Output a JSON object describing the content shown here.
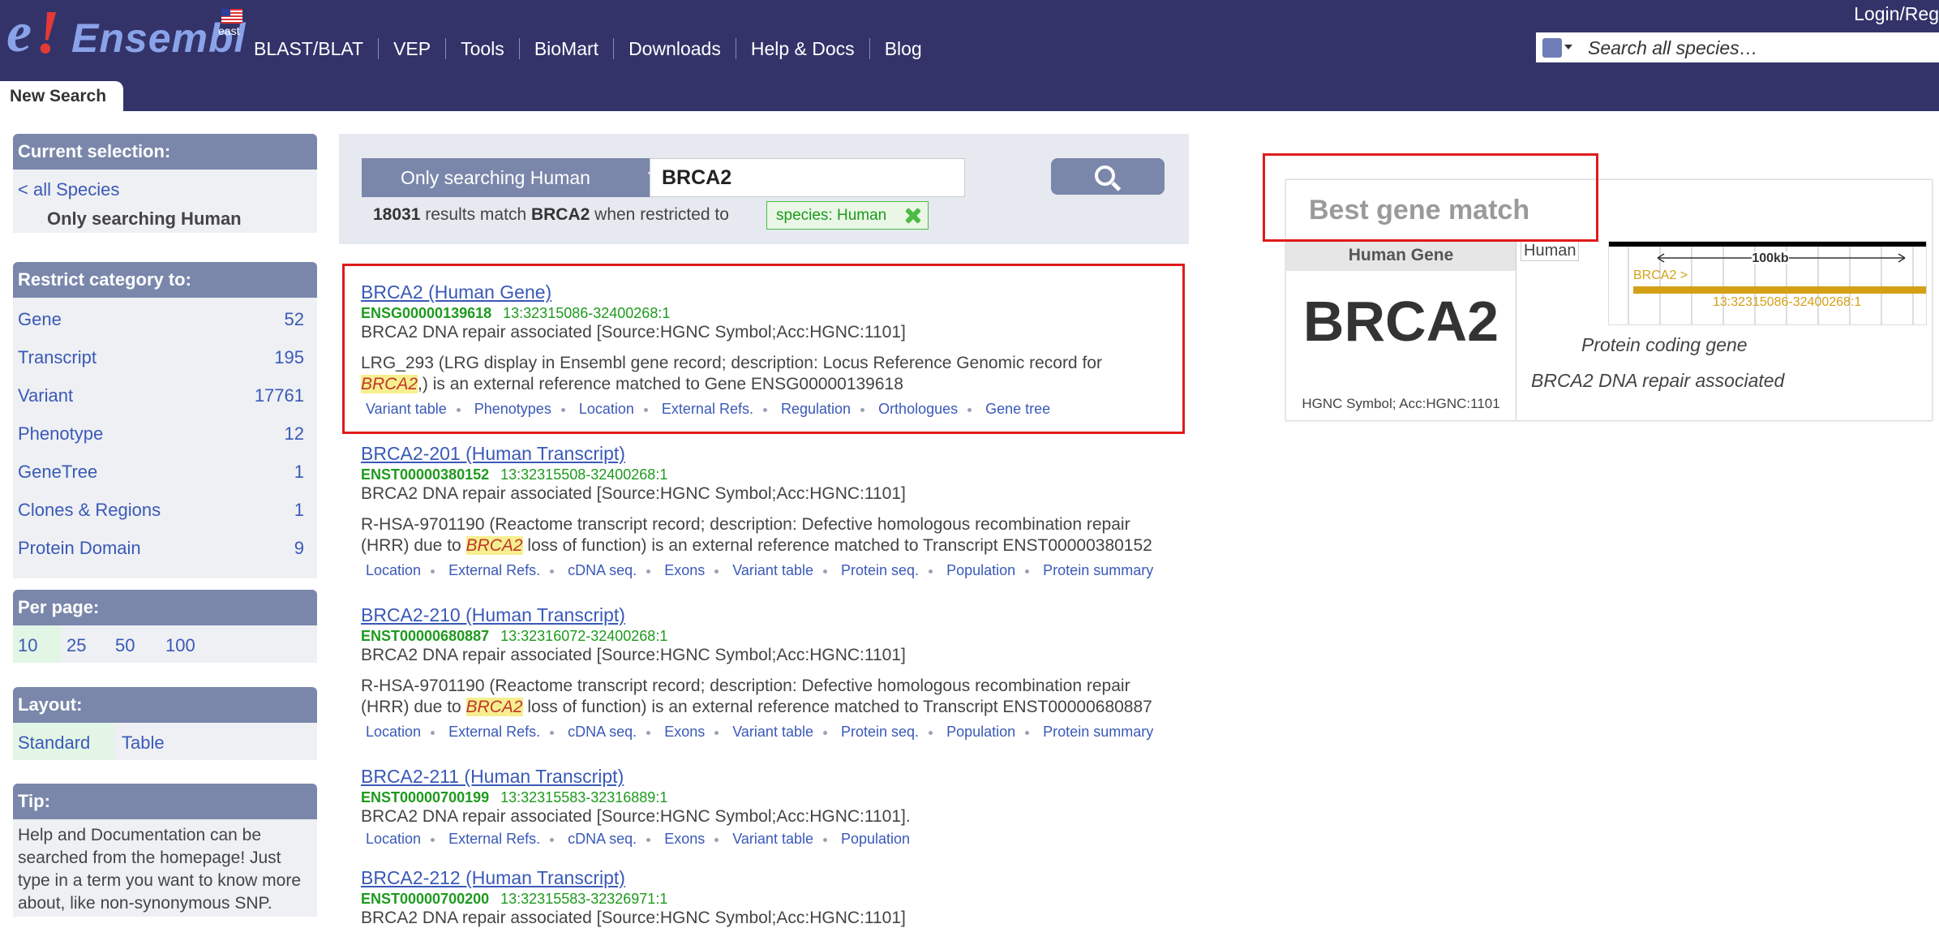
{
  "header": {
    "logo_text": "Ensembl",
    "site_variant": "east",
    "nav": [
      "BLAST/BLAT",
      "VEP",
      "Tools",
      "BioMart",
      "Downloads",
      "Help & Docs",
      "Blog"
    ],
    "login": "Login/Reg",
    "site_search_placeholder": "Search all species…",
    "tab": "New Search"
  },
  "sidebar": {
    "current": {
      "title": "Current selection:",
      "all_species_link": "< all Species",
      "selected": "Only searching Human"
    },
    "restrict": {
      "title": "Restrict category to:",
      "items": [
        {
          "name": "Gene",
          "count": "52"
        },
        {
          "name": "Transcript",
          "count": "195"
        },
        {
          "name": "Variant",
          "count": "17761"
        },
        {
          "name": "Phenotype",
          "count": "12"
        },
        {
          "name": "GeneTree",
          "count": "1"
        },
        {
          "name": "Clones & Regions",
          "count": "1"
        },
        {
          "name": "Protein Domain",
          "count": "9"
        }
      ]
    },
    "per_page": {
      "title": "Per page:",
      "options": [
        "10",
        "25",
        "50",
        "100"
      ],
      "selected": "10"
    },
    "layout": {
      "title": "Layout:",
      "options": [
        "Standard",
        "Table"
      ],
      "selected": "Standard"
    },
    "tip": {
      "title": "Tip:",
      "lines": [
        "Help and Documentation can be",
        "searched from the homepage! Just",
        "type in a term you want to know more",
        "about, like non-synonymous SNP."
      ]
    }
  },
  "search": {
    "restrict_label": "Only searching Human",
    "query": "BRCA2",
    "result_count": "18031",
    "result_mid": "results match",
    "result_query": "BRCA2",
    "result_suffix": "when restricted to",
    "filter_chip": "species: Human"
  },
  "results": [
    {
      "title": "BRCA2 (Human Gene)",
      "stable_id": "ENSG00000139618",
      "location": "13:32315086-32400268:1",
      "desc": "BRCA2 DNA repair associated [Source:HGNC Symbol;Acc:HGNC:1101]",
      "ext_pre": "LRG_293 (LRG display in Ensembl gene record; description: Locus Reference Genomic record for",
      "ext_hl": "BRCA2",
      "ext_post": ",) is an external reference matched to Gene ENSG00000139618",
      "links": [
        "Variant table",
        "Phenotypes",
        "Location",
        "External Refs.",
        "Regulation",
        "Orthologues",
        "Gene tree"
      ]
    },
    {
      "title": "BRCA2-201 (Human Transcript)",
      "stable_id": "ENST00000380152",
      "location": "13:32315508-32400268:1",
      "desc": "BRCA2 DNA repair associated [Source:HGNC Symbol;Acc:HGNC:1101]",
      "ext_pre": "R-HSA-9701190 (Reactome transcript record; description: Defective homologous recombination repair",
      "ext_pre2": "(HRR) due to",
      "ext_hl": "BRCA2",
      "ext_post": "loss of function) is an external reference matched to Transcript ENST00000380152",
      "links": [
        "Location",
        "External Refs.",
        "cDNA seq.",
        "Exons",
        "Variant table",
        "Protein seq.",
        "Population",
        "Protein summary"
      ]
    },
    {
      "title": "BRCA2-210 (Human Transcript)",
      "stable_id": "ENST00000680887",
      "location": "13:32316072-32400268:1",
      "desc": "BRCA2 DNA repair associated [Source:HGNC Symbol;Acc:HGNC:1101]",
      "ext_pre": "R-HSA-9701190 (Reactome transcript record; description: Defective homologous recombination repair",
      "ext_pre2": "(HRR) due to",
      "ext_hl": "BRCA2",
      "ext_post": "loss of function) is an external reference matched to Transcript ENST00000680887",
      "links": [
        "Location",
        "External Refs.",
        "cDNA seq.",
        "Exons",
        "Variant table",
        "Protein seq.",
        "Population",
        "Protein summary"
      ]
    },
    {
      "title": "BRCA2-211 (Human Transcript)",
      "stable_id": "ENST00000700199",
      "location": "13:32315583-32316889:1",
      "desc": "BRCA2 DNA repair associated [Source:HGNC Symbol;Acc:HGNC:1101].",
      "links": [
        "Location",
        "External Refs.",
        "cDNA seq.",
        "Exons",
        "Variant table",
        "Population"
      ]
    },
    {
      "title": "BRCA2-212 (Human Transcript)",
      "stable_id": "ENST00000700200",
      "location": "13:32315583-32326971:1",
      "desc": "BRCA2 DNA repair associated [Source:HGNC Symbol;Acc:HGNC:1101]"
    }
  ],
  "best_match": {
    "title": "Best gene match",
    "header": "Human Gene",
    "symbol": "BRCA2",
    "hgnc": "HGNC Symbol; Acc:HGNC:1101",
    "species_tag": "Human",
    "scale_label": "100kb",
    "track_label": "BRCA2 >",
    "track_location": "13:32315086-32400268:1",
    "type": "Protein coding gene",
    "desc": "BRCA2 DNA repair associated"
  },
  "colors": {
    "masthead": "#33336a",
    "panel_head": "#7a87ab",
    "link": "#3a59b8",
    "stable_id": "#1e9a1e",
    "highlight_box": "#e01b1b",
    "gene_track": "#d4a017"
  }
}
